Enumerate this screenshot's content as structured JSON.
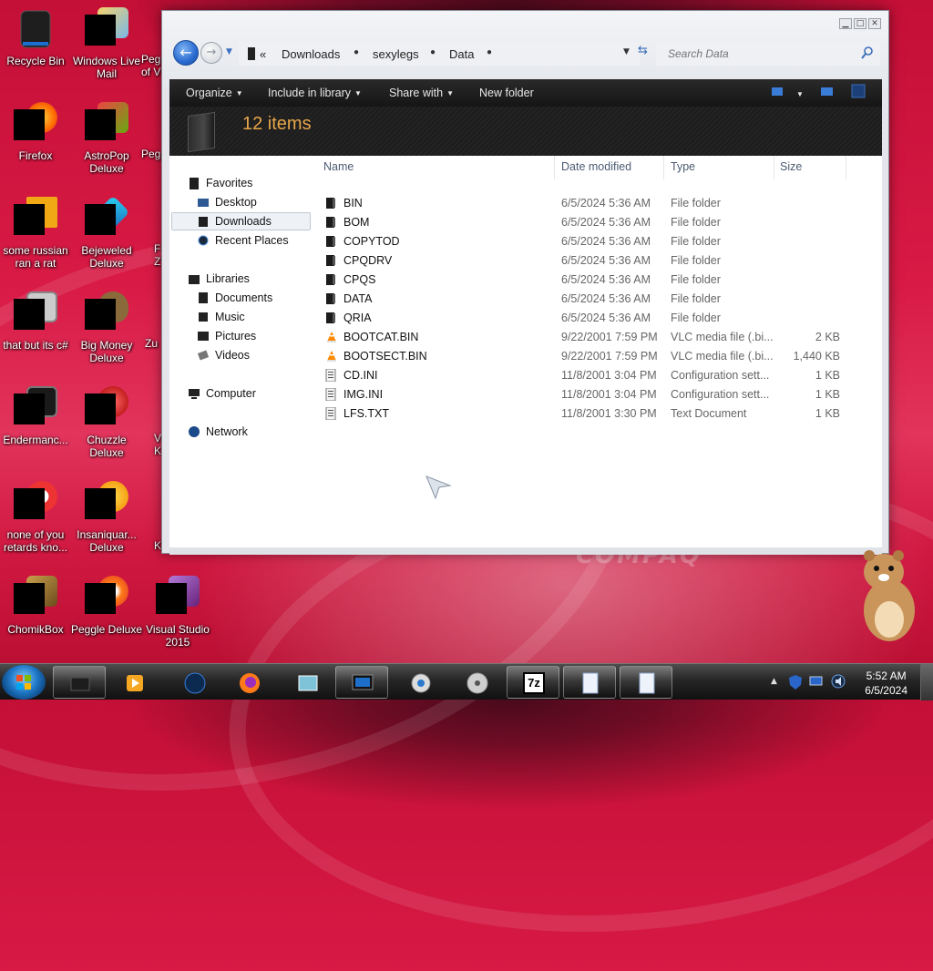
{
  "desktop": {
    "icons": [
      {
        "label": "Recycle Bin",
        "icon": "recycle-bin-icon"
      },
      {
        "label": "Windows Live Mail",
        "icon": "mail-icon"
      },
      {
        "label": "Firefox",
        "icon": "firefox-icon"
      },
      {
        "label": "AstroPop Deluxe",
        "icon": "game-icon"
      },
      {
        "label": "some russian ran a rat",
        "icon": "shortcut-icon"
      },
      {
        "label": "Bejeweled Deluxe",
        "icon": "gem-icon"
      },
      {
        "label": "that but its c#",
        "icon": "shortcut-icon"
      },
      {
        "label": "Big Money Deluxe",
        "icon": "money-bag-icon"
      },
      {
        "label": "Endermanc...",
        "icon": "shortcut-icon"
      },
      {
        "label": "Chuzzle Deluxe",
        "icon": "chuzzle-icon"
      },
      {
        "label": "none of you retards kno...",
        "icon": "shortcut-icon"
      },
      {
        "label": "Insaniquar... Deluxe",
        "icon": "fish-icon"
      },
      {
        "label": "ChomikBox",
        "icon": "hamster-icon"
      },
      {
        "label": "Peggle Deluxe",
        "icon": "peggle-icon"
      },
      {
        "label": "Visual Studio 2015",
        "icon": "visual-studio-icon"
      }
    ],
    "partial_labels": [
      "Peg",
      "of V",
      "Peg",
      "F",
      "Z",
      "Zu",
      "V",
      "K",
      "K"
    ],
    "wallpaper_text": "COMPAQ"
  },
  "window": {
    "caption_buttons": [
      "minimize",
      "maximize",
      "close"
    ],
    "address": {
      "overflow": "«",
      "segments": [
        "Downloads",
        "sexylegs",
        "Data"
      ]
    },
    "search": {
      "placeholder": "Search Data"
    },
    "toolbar": {
      "organize": "Organize",
      "include_in_library": "Include in library",
      "share_with": "Share with",
      "new_folder": "New folder"
    },
    "details": {
      "item_count": "12 items"
    },
    "nav": {
      "favorites": "Favorites",
      "desktop": "Desktop",
      "downloads": "Downloads",
      "recent_places": "Recent Places",
      "libraries": "Libraries",
      "documents": "Documents",
      "music": "Music",
      "pictures": "Pictures",
      "videos": "Videos",
      "computer": "Computer",
      "network": "Network"
    },
    "columns": {
      "name": "Name",
      "date_modified": "Date modified",
      "type": "Type",
      "size": "Size"
    },
    "files": [
      {
        "name": "BIN",
        "date": "6/5/2024 5:36 AM",
        "type": "File folder",
        "size": "",
        "icon": "folder-icon"
      },
      {
        "name": "BOM",
        "date": "6/5/2024 5:36 AM",
        "type": "File folder",
        "size": "",
        "icon": "folder-icon"
      },
      {
        "name": "COPYTOD",
        "date": "6/5/2024 5:36 AM",
        "type": "File folder",
        "size": "",
        "icon": "folder-icon"
      },
      {
        "name": "CPQDRV",
        "date": "6/5/2024 5:36 AM",
        "type": "File folder",
        "size": "",
        "icon": "folder-icon"
      },
      {
        "name": "CPQS",
        "date": "6/5/2024 5:36 AM",
        "type": "File folder",
        "size": "",
        "icon": "folder-icon"
      },
      {
        "name": "DATA",
        "date": "6/5/2024 5:36 AM",
        "type": "File folder",
        "size": "",
        "icon": "folder-icon"
      },
      {
        "name": "QRIA",
        "date": "6/5/2024 5:36 AM",
        "type": "File folder",
        "size": "",
        "icon": "folder-icon"
      },
      {
        "name": "BOOTCAT.BIN",
        "date": "9/22/2001 7:59 PM",
        "type": "VLC media file (.bi...",
        "size": "2 KB",
        "icon": "vlc-icon"
      },
      {
        "name": "BOOTSECT.BIN",
        "date": "9/22/2001 7:59 PM",
        "type": "VLC media file (.bi...",
        "size": "1,440 KB",
        "icon": "vlc-icon"
      },
      {
        "name": "CD.INI",
        "date": "11/8/2001 3:04 PM",
        "type": "Configuration sett...",
        "size": "1 KB",
        "icon": "config-file-icon"
      },
      {
        "name": "IMG.INI",
        "date": "11/8/2001 3:04 PM",
        "type": "Configuration sett...",
        "size": "1 KB",
        "icon": "config-file-icon"
      },
      {
        "name": "LFS.TXT",
        "date": "11/8/2001 3:30 PM",
        "type": "Text Document",
        "size": "1 KB",
        "icon": "text-file-icon"
      }
    ]
  },
  "taskbar": {
    "apps": [
      "explorer-icon",
      "media-player-icon",
      "app-icon",
      "firefox-icon",
      "folder-app-icon",
      "screen-icon",
      "media-center-icon",
      "dvd-icon",
      "seven-zip-icon",
      "document-icon",
      "document-icon"
    ],
    "seven_zip_label": "7z",
    "tray_expand": "▲",
    "clock": {
      "time": "5:52 AM",
      "date": "6/5/2024"
    }
  },
  "colors": {
    "accent_orange": "#e8a64a",
    "wallpaper_red": "#d81a45",
    "window_frame": "#e3e5ea"
  }
}
